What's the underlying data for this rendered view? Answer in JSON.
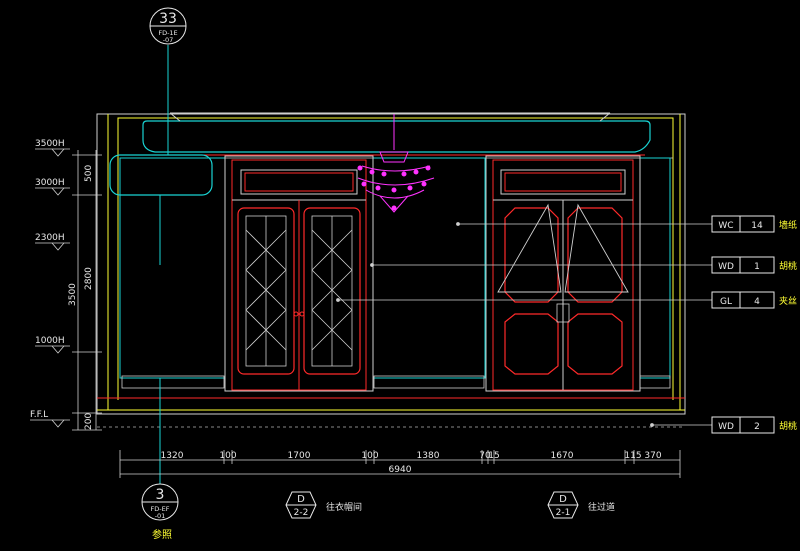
{
  "section_bubble_top": {
    "number": "33",
    "ref": "FD-1E",
    "ref2": "-07"
  },
  "section_bubble_bottom": {
    "number": "3",
    "ref": "FD-EF",
    "ref2": "-01",
    "caption": "参照"
  },
  "level_marks": [
    {
      "label": "3500H"
    },
    {
      "label": "3000H"
    },
    {
      "label": "2300H"
    },
    {
      "label": "1000H"
    },
    {
      "label": "F.F.L"
    }
  ],
  "vertical_dims": {
    "d500": "500",
    "d3500": "3500",
    "d2800": "2800",
    "d200": "200"
  },
  "horizontal_dims": [
    "1320",
    "100",
    "1700",
    "100",
    "1380",
    "70",
    "15",
    "1670",
    "115",
    "370"
  ],
  "total_dim": "6940",
  "elevation_tags": [
    {
      "letter": "D",
      "num": "2-2",
      "label": "往衣帽间"
    },
    {
      "letter": "D",
      "num": "2-1",
      "label": "往过道"
    }
  ],
  "material_tags": [
    {
      "code": "WC",
      "num": "14",
      "label": "墙纸"
    },
    {
      "code": "WD",
      "num": "1",
      "label": "胡桃"
    },
    {
      "code": "GL",
      "num": "4",
      "label": "夹丝"
    },
    {
      "code": "WD",
      "num": "2",
      "label": "胡桃"
    }
  ],
  "colors": {
    "background": "#000000",
    "red": "#ff2a2a",
    "cyan": "#19d3d3",
    "yellow": "#ffff33",
    "magenta": "#ff33ff",
    "white": "#e8e8e8"
  }
}
